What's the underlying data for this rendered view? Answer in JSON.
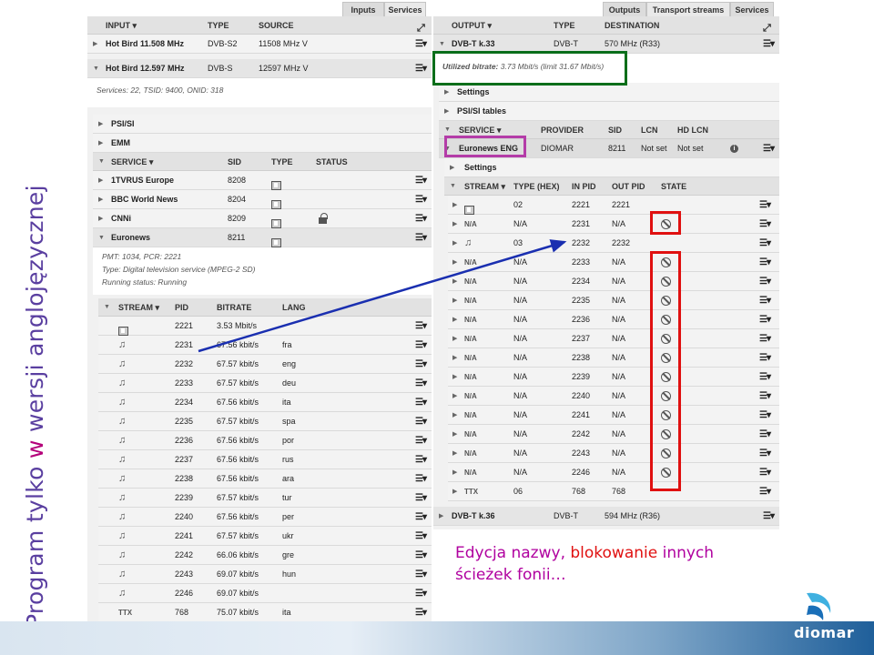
{
  "slide": {
    "vertical_title_part1": "Program tylko ",
    "vertical_title_w": "w",
    "vertical_title_part2": " wersji anglojęzycznej",
    "caption_part1": "Edycja nazwy, ",
    "caption_red": "blokowanie",
    "caption_part2": " innych ścieżek fonii…",
    "logo_text": "diomar",
    "colors": {
      "title": "#5a3fa0",
      "accent_magenta": "#b0009f",
      "red": "#e01010",
      "green": "#0a6e1a",
      "blue_arrow": "#1a2fb0",
      "highlight_magenta": "#b43ca8"
    }
  },
  "left": {
    "tabs": [
      "Inputs",
      "Services"
    ],
    "header": {
      "input": "INPUT ▾",
      "type": "TYPE",
      "source": "SOURCE"
    },
    "inputs": [
      {
        "name": "Hot Bird 11.508 MHz",
        "type": "DVB-S2",
        "source": "11508 MHz V"
      },
      {
        "name": "Hot Bird 12.597 MHz",
        "type": "DVB-S",
        "source": "12597 MHz V"
      }
    ],
    "input_info": "Services: 22, TSID: 9400, ONID: 318",
    "sections": [
      "PSI/SI",
      "EMM"
    ],
    "service_header": {
      "service": "SERVICE ▾",
      "sid": "SID",
      "type": "TYPE",
      "status": "STATUS"
    },
    "services": [
      {
        "name": "1TVRUS Europe",
        "sid": "8208"
      },
      {
        "name": "BBC World News",
        "sid": "8204"
      },
      {
        "name": "CNNi",
        "sid": "8209"
      },
      {
        "name": "Euronews",
        "sid": "8211"
      }
    ],
    "service_info": {
      "line1": "PMT: 1034, PCR: 2221",
      "line2": "Type: Digital television service (MPEG-2 SD)",
      "line3": "Running status: Running"
    },
    "stream_header": {
      "stream": "STREAM ▾",
      "pid": "PID",
      "bitrate": "BITRATE",
      "lang": "LANG"
    },
    "streams": [
      {
        "icon": "video-icon",
        "pid": "2221",
        "bitrate": "3.53 Mbit/s",
        "lang": ""
      },
      {
        "icon": "audio-icon",
        "pid": "2231",
        "bitrate": "67.56 kbit/s",
        "lang": "fra"
      },
      {
        "icon": "audio-icon",
        "pid": "2232",
        "bitrate": "67.57 kbit/s",
        "lang": "eng"
      },
      {
        "icon": "audio-icon",
        "pid": "2233",
        "bitrate": "67.57 kbit/s",
        "lang": "deu"
      },
      {
        "icon": "audio-icon",
        "pid": "2234",
        "bitrate": "67.56 kbit/s",
        "lang": "ita"
      },
      {
        "icon": "audio-icon",
        "pid": "2235",
        "bitrate": "67.57 kbit/s",
        "lang": "spa"
      },
      {
        "icon": "audio-icon",
        "pid": "2236",
        "bitrate": "67.56 kbit/s",
        "lang": "por"
      },
      {
        "icon": "audio-icon",
        "pid": "2237",
        "bitrate": "67.56 kbit/s",
        "lang": "rus"
      },
      {
        "icon": "audio-icon",
        "pid": "2238",
        "bitrate": "67.56 kbit/s",
        "lang": "ara"
      },
      {
        "icon": "audio-icon",
        "pid": "2239",
        "bitrate": "67.57 kbit/s",
        "lang": "tur"
      },
      {
        "icon": "audio-icon",
        "pid": "2240",
        "bitrate": "67.56 kbit/s",
        "lang": "per"
      },
      {
        "icon": "audio-icon",
        "pid": "2241",
        "bitrate": "67.57 kbit/s",
        "lang": "ukr"
      },
      {
        "icon": "audio-icon",
        "pid": "2242",
        "bitrate": "66.06 kbit/s",
        "lang": "gre"
      },
      {
        "icon": "audio-icon",
        "pid": "2243",
        "bitrate": "69.07 kbit/s",
        "lang": "hun"
      },
      {
        "icon": "audio-icon",
        "pid": "2246",
        "bitrate": "69.07 kbit/s",
        "lang": ""
      },
      {
        "icon": "teletext-icon",
        "pid": "768",
        "bitrate": "75.07 kbit/s",
        "lang": "ita"
      }
    ]
  },
  "right": {
    "tabs": [
      "Outputs",
      "Transport streams",
      "Services"
    ],
    "header": {
      "output": "OUTPUT ▾",
      "type": "TYPE",
      "destination": "DESTINATION"
    },
    "outputs": [
      {
        "name": "DVB-T k.33",
        "type": "DVB-T",
        "destination": "570 MHz (R33)"
      },
      {
        "name": "DVB-T k.36",
        "type": "DVB-T",
        "destination": "594 MHz (R36)"
      }
    ],
    "bitrate_label": "Utilized bitrate:",
    "bitrate_value": "3.73 Mbit/s (limit 31.67 Mbit/s)",
    "sections": [
      "Settings",
      "PSI/SI tables"
    ],
    "service_header": {
      "service": "SERVICE ▾",
      "provider": "PROVIDER",
      "sid": "SID",
      "lcn": "LCN",
      "hdlcn": "HD LCN"
    },
    "service": {
      "name": "Euronews ENG",
      "provider": "DIOMAR",
      "sid": "8211",
      "lcn": "Not set",
      "hdlcn": "Not set"
    },
    "service_settings": "Settings",
    "stream_header": {
      "stream": "STREAM ▾",
      "typehex": "TYPE (HEX)",
      "inpid": "IN PID",
      "outpid": "OUT PID",
      "state": "STATE"
    },
    "streams": [
      {
        "icon": "video-icon",
        "label": "",
        "typehex": "02",
        "inpid": "2221",
        "outpid": "2221",
        "blocked": false
      },
      {
        "icon": "",
        "label": "N/A",
        "typehex": "N/A",
        "inpid": "2231",
        "outpid": "N/A",
        "blocked": true
      },
      {
        "icon": "audio-icon",
        "label": "",
        "typehex": "03",
        "inpid": "2232",
        "outpid": "2232",
        "blocked": false
      },
      {
        "icon": "",
        "label": "N/A",
        "typehex": "N/A",
        "inpid": "2233",
        "outpid": "N/A",
        "blocked": true
      },
      {
        "icon": "",
        "label": "N/A",
        "typehex": "N/A",
        "inpid": "2234",
        "outpid": "N/A",
        "blocked": true
      },
      {
        "icon": "",
        "label": "N/A",
        "typehex": "N/A",
        "inpid": "2235",
        "outpid": "N/A",
        "blocked": true
      },
      {
        "icon": "",
        "label": "N/A",
        "typehex": "N/A",
        "inpid": "2236",
        "outpid": "N/A",
        "blocked": true
      },
      {
        "icon": "",
        "label": "N/A",
        "typehex": "N/A",
        "inpid": "2237",
        "outpid": "N/A",
        "blocked": true
      },
      {
        "icon": "",
        "label": "N/A",
        "typehex": "N/A",
        "inpid": "2238",
        "outpid": "N/A",
        "blocked": true
      },
      {
        "icon": "",
        "label": "N/A",
        "typehex": "N/A",
        "inpid": "2239",
        "outpid": "N/A",
        "blocked": true
      },
      {
        "icon": "",
        "label": "N/A",
        "typehex": "N/A",
        "inpid": "2240",
        "outpid": "N/A",
        "blocked": true
      },
      {
        "icon": "",
        "label": "N/A",
        "typehex": "N/A",
        "inpid": "2241",
        "outpid": "N/A",
        "blocked": true
      },
      {
        "icon": "",
        "label": "N/A",
        "typehex": "N/A",
        "inpid": "2242",
        "outpid": "N/A",
        "blocked": true
      },
      {
        "icon": "",
        "label": "N/A",
        "typehex": "N/A",
        "inpid": "2243",
        "outpid": "N/A",
        "blocked": true
      },
      {
        "icon": "",
        "label": "N/A",
        "typehex": "N/A",
        "inpid": "2246",
        "outpid": "N/A",
        "blocked": true
      },
      {
        "icon": "teletext-icon",
        "label": "TTX",
        "typehex": "06",
        "inpid": "768",
        "outpid": "768",
        "blocked": false
      }
    ]
  }
}
